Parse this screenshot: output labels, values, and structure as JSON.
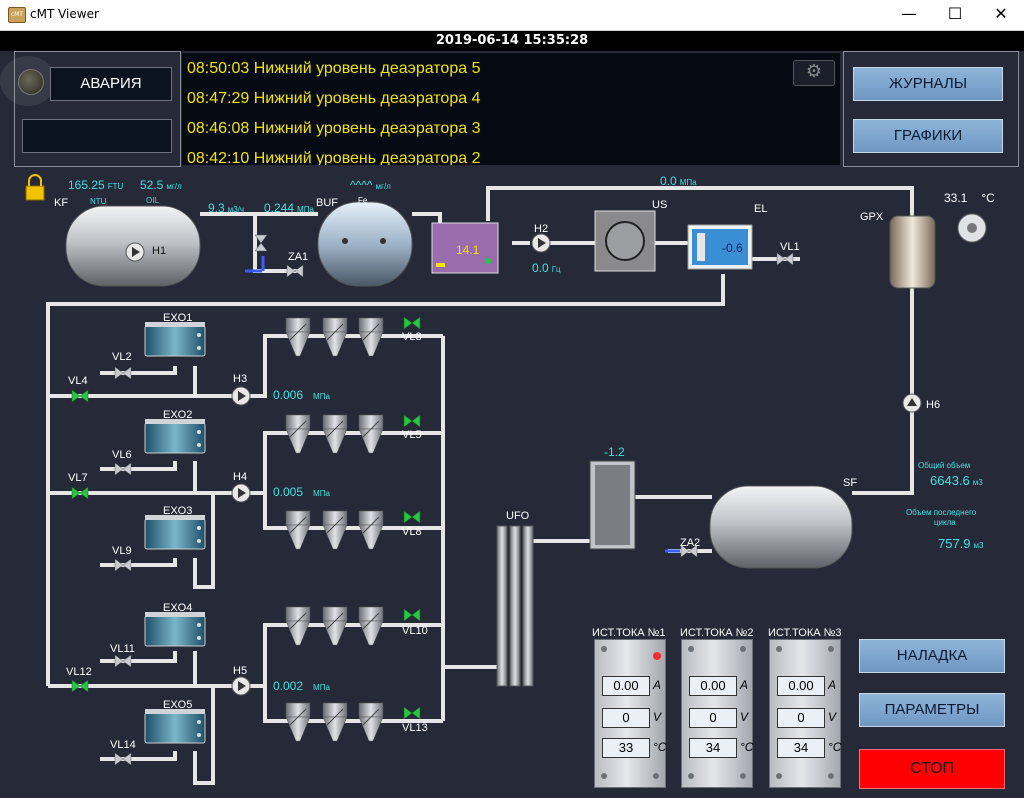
{
  "window": {
    "title": "cMT Viewer",
    "minimize": "—",
    "maximize": "☐",
    "close": "✕"
  },
  "datetime": "2019-06-14 15:35:28",
  "alarm": {
    "label": "АВАРИЯ"
  },
  "log": [
    "08:50:03 Нижний уровень деаэратора 5",
    "08:47:29 Нижний уровень деаэратора 4",
    "08:46:08 Нижний уровень деаэратора 3",
    "08:42:10 Нижний уровень деаэратора 2"
  ],
  "buttons": {
    "journals": "ЖУРНАЛЫ",
    "graphs": "ГРАФИКИ",
    "setup": "НАЛАДКА",
    "params": "ПАРАМЕТРЫ",
    "stop": "СТОП"
  },
  "tags": {
    "kf": "KF",
    "h1": "H1",
    "buf": "BUF",
    "fe": "Fe",
    "za1": "ZA1",
    "h2": "H2",
    "us": "US",
    "el": "EL",
    "vl1": "VL1",
    "gpx": "GPX",
    "h6": "H6",
    "sf": "SF",
    "za2": "ZA2",
    "ufo": "UFO",
    "h3": "H3",
    "h4": "H4",
    "h5": "H5",
    "exo1": "EXO1",
    "exo2": "EXO2",
    "exo3": "EXO3",
    "exo4": "EXO4",
    "exo5": "EXO5",
    "vl2": "VL2",
    "vl3": "VL3",
    "vl4": "VL4",
    "vl5": "VL5",
    "vl6": "VL6",
    "vl7": "VL7",
    "vl8": "VL8",
    "vl9": "VL9",
    "vl10": "VL10",
    "vl11": "VL11",
    "vl12": "VL12",
    "vl13": "VL13",
    "vl14": "VL14",
    "ntu": "NTU",
    "oil": "OIL"
  },
  "values": {
    "turbidity": "165.25",
    "turbidity_unit": "FTU",
    "oil": "52.5",
    "oil_unit": "мг/л",
    "fe": "^^^^",
    "fe_unit": "мг/л",
    "flow": "9.3",
    "flow_unit": "м3/ч",
    "pressure1": "0.244",
    "pressure1_unit": "МПа",
    "tank_level": "14.1",
    "pressure_top": "0.0",
    "pressure_top_unit": "МПа",
    "freq": "0.0",
    "freq_unit": "Гц",
    "el_level": "-0.6",
    "temp": "33.1",
    "temp_unit": "°C",
    "h3_pressure": "0.006",
    "h4_pressure": "0.005",
    "h5_pressure": "0.002",
    "pressure_unit": "МПа",
    "ufo_level": "-1.2",
    "total_volume_label": "Общий объем",
    "total_volume": "6643.6",
    "volume_unit": "м3",
    "last_cycle_label1": "Объем последнего",
    "last_cycle_label2": "цикла",
    "last_cycle": "757.9"
  },
  "power": [
    {
      "title": "ИСТ.ТОКА №1",
      "amps": "0.00",
      "volts": "0",
      "temp": "33"
    },
    {
      "title": "ИСТ.ТОКА №2",
      "amps": "0.00",
      "volts": "0",
      "temp": "34"
    },
    {
      "title": "ИСТ.ТОКА №3",
      "amps": "0.00",
      "volts": "0",
      "temp": "34"
    }
  ],
  "power_units": {
    "a": "A",
    "v": "V",
    "c": "°C"
  },
  "colors": {
    "background": "#262a38",
    "pipe": "#e6e6e6",
    "valve_open": "#25c640",
    "log_text": "#f2e400",
    "value_text": "#3fe0e0",
    "stop": "#ff0000"
  }
}
